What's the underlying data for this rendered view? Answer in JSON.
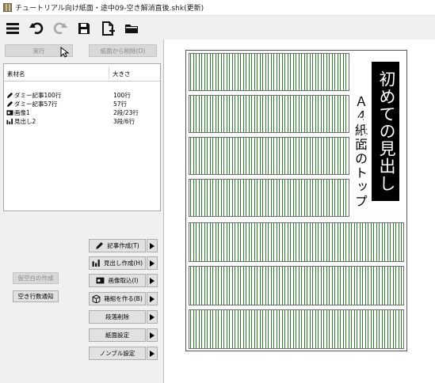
{
  "window": {
    "title": "チュートリアル向け紙面・途中09-空き解消直後.shk(更新)"
  },
  "toolbar": {
    "buttons": [
      {
        "name": "menu-icon"
      },
      {
        "name": "undo-icon"
      },
      {
        "name": "redo-icon"
      },
      {
        "name": "save-icon"
      },
      {
        "name": "new-file-icon"
      },
      {
        "name": "open-folder-icon"
      }
    ]
  },
  "actions": {
    "run_label": "実行",
    "remove_label": "紙面から削除(D)"
  },
  "material_list": {
    "col_name": "素材名",
    "col_size": "大きさ",
    "rows": [
      {
        "icon": "pen-icon",
        "name": "ダミー記事100行",
        "size": "100行"
      },
      {
        "icon": "pen-icon",
        "name": "ダミー記事57行",
        "size": "57行"
      },
      {
        "icon": "image-icon",
        "name": "画像1",
        "size": "2段/23行"
      },
      {
        "icon": "bar-chart-icon",
        "name": "見出し2",
        "size": "3段/6行"
      }
    ]
  },
  "left_buttons": {
    "blank_create": "仮空白の作成",
    "blank_notify": "空き行数通知"
  },
  "side_actions": [
    {
      "icon": "pen-icon",
      "label": "記事作成(T)"
    },
    {
      "icon": "bar-chart-icon",
      "label": "見出し作成(H)"
    },
    {
      "icon": "image-icon",
      "label": "画像取込(I)"
    },
    {
      "icon": "box-icon",
      "label": "箱組を作る(B)"
    },
    {
      "icon": "",
      "label": "段落削除"
    },
    {
      "icon": "",
      "label": "紙面設定"
    },
    {
      "icon": "",
      "label": "ノンブル設定"
    }
  ],
  "preview": {
    "headline": "初めての見出し作り",
    "subtitle": "Ａ４紙面のトップ"
  },
  "colors": {
    "column_lines": "#2f7a2f",
    "headline_bg": "#000000"
  }
}
